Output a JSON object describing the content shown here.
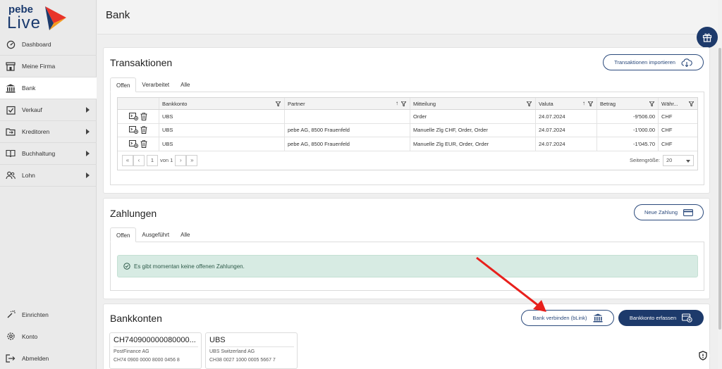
{
  "app": {
    "logo_top": "pebe",
    "logo_bottom": "Live"
  },
  "sidebar": {
    "items": [
      {
        "label": "Dashboard",
        "icon": "gauge-icon"
      },
      {
        "label": "Meine Firma",
        "icon": "storefront-icon"
      },
      {
        "label": "Bank",
        "icon": "bank-icon",
        "active": true
      },
      {
        "label": "Verkauf",
        "icon": "checkbox-icon",
        "expandable": true
      },
      {
        "label": "Kreditoren",
        "icon": "folder-arrow-icon",
        "expandable": true
      },
      {
        "label": "Buchhaltung",
        "icon": "book-icon",
        "expandable": true
      },
      {
        "label": "Lohn",
        "icon": "people-icon",
        "expandable": true
      }
    ],
    "bottom": [
      {
        "label": "Einrichten",
        "icon": "wand-icon"
      },
      {
        "label": "Konto",
        "icon": "gear-icon"
      },
      {
        "label": "Abmelden",
        "icon": "logout-icon"
      }
    ]
  },
  "header": {
    "title": "Bank"
  },
  "transaktionen": {
    "title": "Transaktionen",
    "import_button": "Transaktionen importieren",
    "tabs": [
      "Offen",
      "Verarbeitet",
      "Alle"
    ],
    "columns": [
      "Bankkonto",
      "Partner",
      "Mitteilung",
      "Valuta",
      "Betrag",
      "Währ..."
    ],
    "rows": [
      {
        "bankkonto": "UBS",
        "partner": "",
        "mitteilung": "Order",
        "valuta": "24.07.2024",
        "betrag": "-9'506.00",
        "waehrung": "CHF"
      },
      {
        "bankkonto": "UBS",
        "partner": "pebe AG, 8500 Frauenfeld",
        "mitteilung": "Manuelle Zlg CHF, Order, Order",
        "valuta": "24.07.2024",
        "betrag": "-1'000.00",
        "waehrung": "CHF"
      },
      {
        "bankkonto": "UBS",
        "partner": "pebe AG, 8500 Frauenfeld",
        "mitteilung": "Manuelle Zlg EUR, Order, Order",
        "valuta": "24.07.2024",
        "betrag": "-1'045.70",
        "waehrung": "CHF"
      }
    ],
    "pager": {
      "current_page": "1",
      "of_pages": "von 1",
      "page_size_label": "Seitengröße:",
      "page_size": "20"
    }
  },
  "zahlungen": {
    "title": "Zahlungen",
    "new_button": "Neue Zahlung",
    "tabs": [
      "Offen",
      "Ausgeführt",
      "Alle"
    ],
    "empty_message": "Es gibt momentan keine offenen Zahlungen."
  },
  "bankkonten": {
    "title": "Bankkonten",
    "connect_button": "Bank verbinden (bLink)",
    "add_button": "Bankkonto erfassen",
    "cards": [
      {
        "title": "CH740900000080000...",
        "bank": "PostFinance AG",
        "iban": "CH74 0900 0000 8000 0456 8"
      },
      {
        "title": "UBS",
        "bank": "UBS Switzerland AG",
        "iban": "CH38 0027 1000 0005 5667 7"
      }
    ]
  },
  "colors": {
    "primary": "#1d3a6b",
    "alert_bg": "#d7ebe3",
    "annotation_arrow": "#e8201c"
  }
}
